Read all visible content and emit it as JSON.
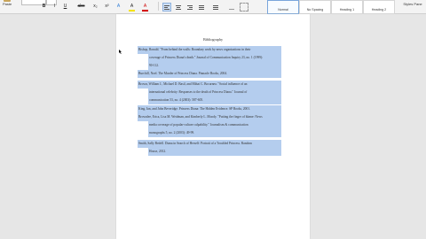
{
  "ribbon": {
    "paste_label": "Paste",
    "bold": "B",
    "italic": "I",
    "underline": "U",
    "strike": "abc",
    "sub": "x₂",
    "sup": "x²",
    "highlight": "A",
    "styles": [
      {
        "label": "Normal",
        "selected": true
      },
      {
        "label": "No Spacing",
        "selected": false
      },
      {
        "label": "Heading 1",
        "selected": false
      },
      {
        "label": "Heading 2",
        "selected": false
      }
    ],
    "styles_pane_label": "Styles Pane"
  },
  "document": {
    "title": "Bibliography",
    "entries": [
      {
        "lines": [
          "Bishop, Ronald. \"From behind the walls: Boundary work by news organizations in their",
          "coverage of Princess Diana's death.\" Journal of Communication Inquiry 23, no. 1 (1999):",
          "90-112."
        ]
      },
      {
        "lines": [
          "Burchill, Noel. The Murder of Princess Diana. Pinnacle Books, 2004."
        ]
      },
      {
        "lines": [
          "Brown, William J., Michael D. Basil, and Mihai C. Bocarnea. \"Social influence of an",
          "international celebrity: Responses to the death of Princess Diana.\" Journal of",
          "communication 53, no. 4 (2003): 587-605."
        ]
      },
      {
        "lines": [
          "King, Ian, and John Beveridge. Princess Diana: The Hidden Evidence. SP Books, 2001."
        ]
      },
      {
        "lines": [
          "Brownlee, Erica, Lisa M. Weidman, and Kimberly L. Moody. \"Putting the finger of blame: News",
          "media coverage of popular-culture culpability.\" Journalism & communication",
          "monographs 5, no. 2 (2003): 49-99."
        ]
      },
      {
        "lines": [
          "Smith, Sally Bedell. Diana in Search of Herself: Portrait of a Troubled Princess. Random",
          "House, 2012."
        ]
      }
    ]
  }
}
